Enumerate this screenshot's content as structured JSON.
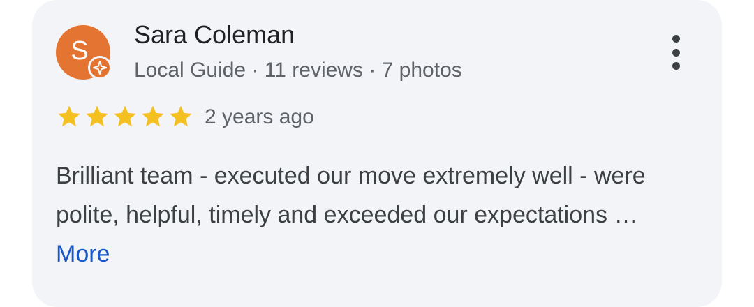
{
  "review": {
    "reviewer_name": "Sara Coleman",
    "avatar_initial": "S",
    "guide_label": "Local Guide",
    "meta_separator": "·",
    "reviews_count": "11 reviews",
    "photos_count": "7 photos",
    "rating": 5,
    "rating_max": 5,
    "time_ago": "2 years ago",
    "text": "Brilliant team - executed our move extremely well - were polite, helpful, timely and exceeded our expectations …",
    "more_label": "More"
  },
  "colors": {
    "avatar_bg": "#e47431",
    "star": "#f4c020",
    "link": "#1a57c8",
    "card_bg": "#f3f4f7"
  },
  "icons": {
    "guide_badge": "local-guide-star-icon",
    "menu": "more-vert-icon",
    "rating_star": "star-icon"
  }
}
